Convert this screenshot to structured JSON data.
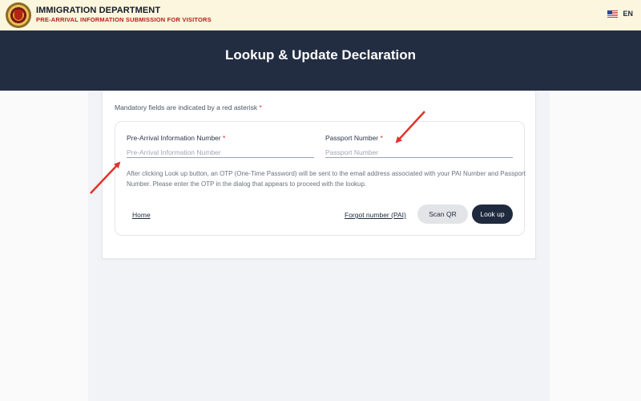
{
  "header": {
    "org_name": "IMMIGRATION DEPARTMENT",
    "subtitle": "PRE-ARRIVAL INFORMATION SUBMISSION FOR VISITORS",
    "language": "EN"
  },
  "hero": {
    "title": "Lookup & Update Declaration"
  },
  "form": {
    "mandatory_note": "Mandatory fields are indicated by a red asterisk",
    "required_marker": "*",
    "pai": {
      "label": "Pre-Arrival Information Number",
      "placeholder": "Pre-Arrival Information Number",
      "value": ""
    },
    "passport": {
      "label": "Passport Number",
      "placeholder": "Passport Number",
      "value": ""
    },
    "help_text": "After clicking Look up button, an OTP (One-Time Password) will be sent to the email address associated with your PAI Number and Passport Number. Please enter the OTP in the dialog that appears to proceed with the lookup.",
    "home_link": "Home",
    "forgot_link": "Forgot number (PAI)",
    "scan_button": "Scan QR",
    "lookup_button": "Look up"
  },
  "colors": {
    "header_bg": "#fbf6dd",
    "hero_bg": "#232d42",
    "required_star": "#d32f2f",
    "annotation_arrow": "#e0332b",
    "primary_button": "#1f2a3e"
  },
  "icons": {
    "logo": "department-seal-icon",
    "language": "us-flag-icon",
    "annotations": "red-arrow-icon"
  }
}
